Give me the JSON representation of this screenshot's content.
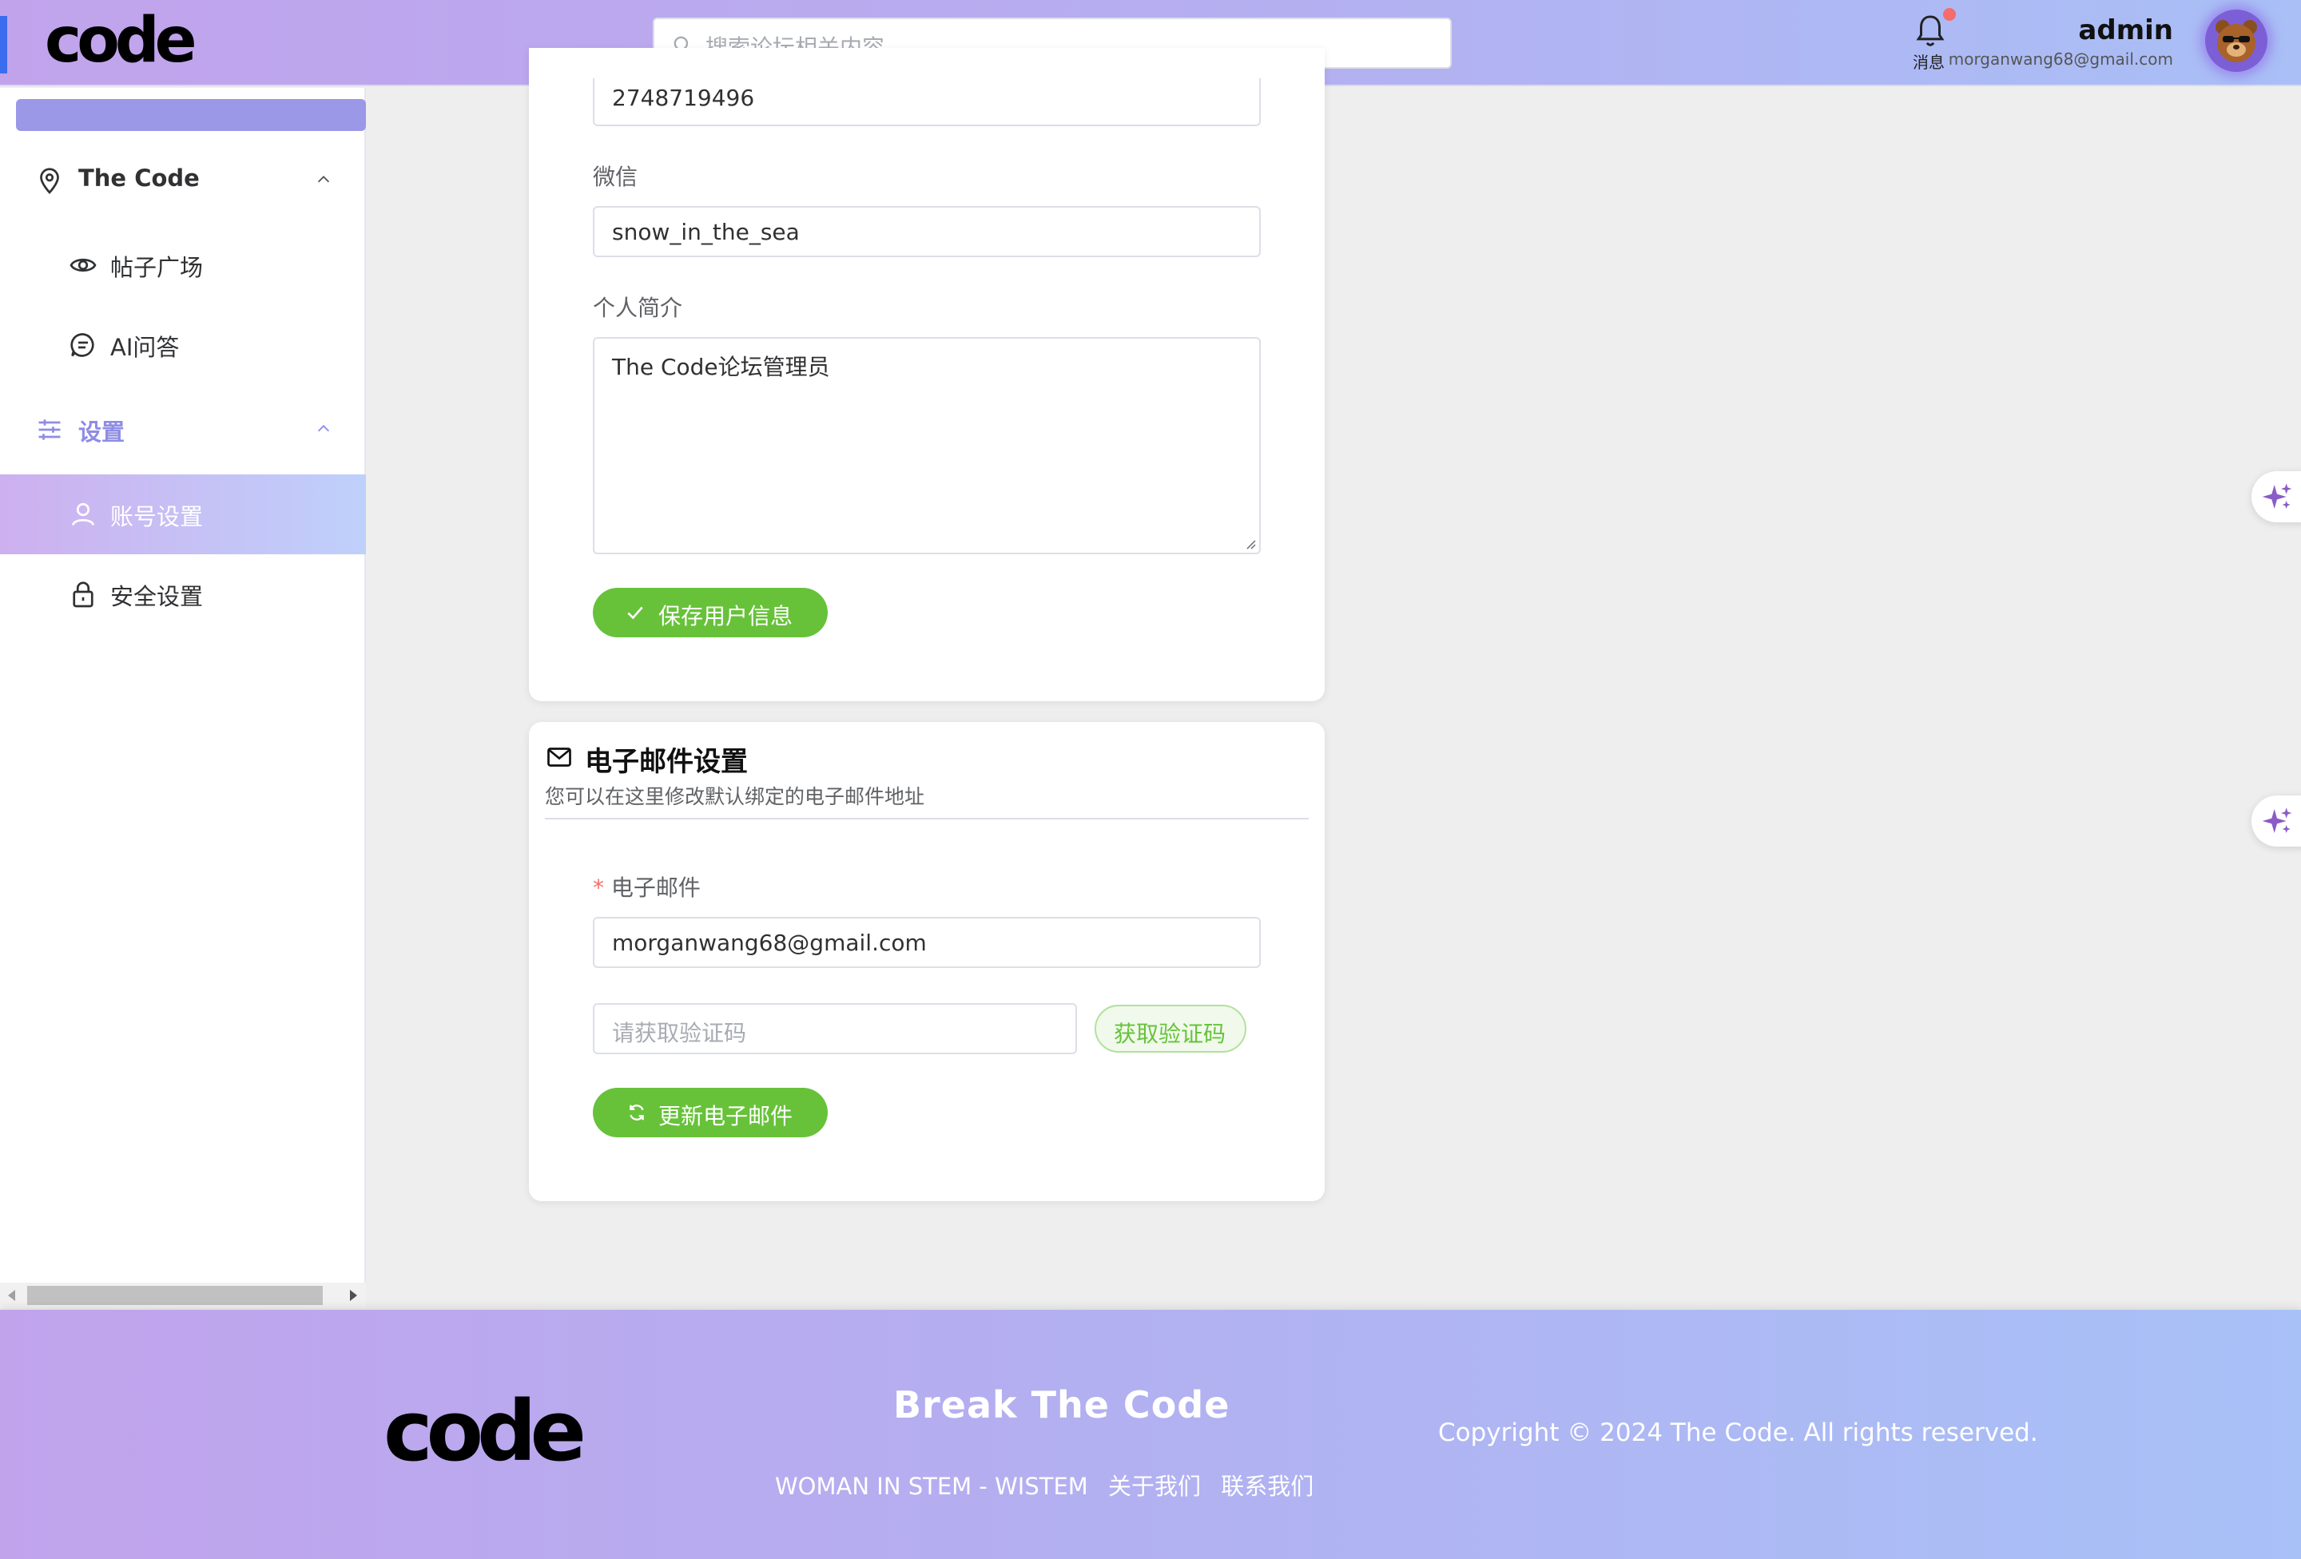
{
  "header": {
    "logo": "code",
    "search_placeholder": "搜索论坛相关内容...",
    "bell_label": "消息",
    "user_name": "admin",
    "user_email": "morganwang68@gmail.com"
  },
  "sidebar": {
    "groups": [
      {
        "label": "The Code",
        "icon": "location-pin-icon",
        "expanded": true,
        "items": [
          {
            "label": "帖子广场",
            "icon": "eye-icon"
          },
          {
            "label": "AI问答",
            "icon": "chat-bubble-icon"
          }
        ]
      },
      {
        "label": "设置",
        "icon": "sliders-icon",
        "expanded": true,
        "items": [
          {
            "label": "账号设置",
            "icon": "user-icon",
            "active": true
          },
          {
            "label": "安全设置",
            "icon": "lock-icon"
          }
        ]
      }
    ]
  },
  "profile_form": {
    "qq_value": "2748719496",
    "wechat_label": "微信",
    "wechat_value": "snow_in_the_sea",
    "bio_label": "个人简介",
    "bio_value": "The Code论坛管理员",
    "save_button": "保存用户信息"
  },
  "email_section": {
    "title": "电子邮件设置",
    "subtitle": "您可以在这里修改默认绑定的电子邮件地址",
    "email_label": "电子邮件",
    "required_mark": "*",
    "email_value": "morganwang68@gmail.com",
    "code_placeholder": "请获取验证码",
    "get_code_button": "获取验证码",
    "update_button": "更新电子邮件"
  },
  "footer": {
    "logo": "code",
    "slogan": "Break The Code",
    "links": [
      "WOMAN IN STEM - WISTEM",
      "关于我们",
      "联系我们"
    ],
    "copyright": "Copyright © 2024 The Code. All rights reserved."
  },
  "colors": {
    "accent_purple": "#9b98e8",
    "success_green": "#67c23a",
    "danger_red": "#f56c6c"
  }
}
